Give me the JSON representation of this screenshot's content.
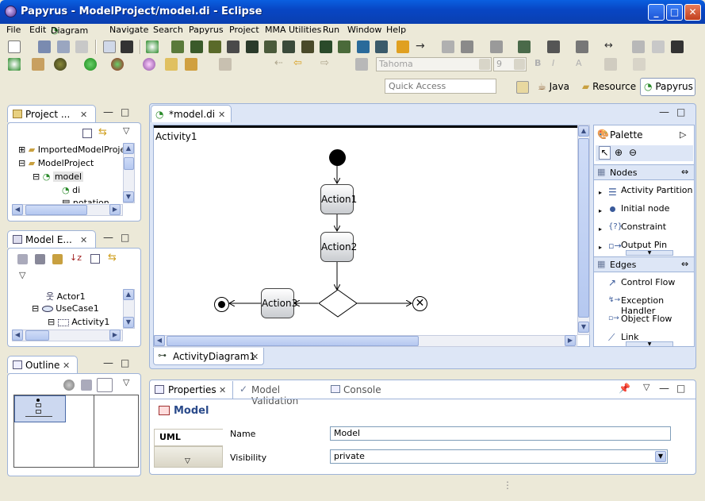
{
  "window": {
    "title": "Papyrus - ModelProject/model.di - Eclipse",
    "buttons": [
      "_",
      "□",
      "✕"
    ]
  },
  "menu": [
    "File",
    "Edit",
    "Diagram",
    "Navigate",
    "Search",
    "Papyrus",
    "Project",
    "MMA Utilities",
    "Run",
    "Window",
    "Help"
  ],
  "toolbar": {
    "font_name": "Tahoma",
    "font_size": "9",
    "quick_access_placeholder": "Quick Access",
    "perspectives": [
      {
        "label": "Java",
        "active": false
      },
      {
        "label": "Resource",
        "active": false
      },
      {
        "label": "Papyrus",
        "active": true
      }
    ]
  },
  "project_explorer": {
    "tab_label": "Project ...",
    "items": [
      {
        "label": "ImportedModelProject",
        "level": 0,
        "expander": "+"
      },
      {
        "label": "ModelProject",
        "level": 0,
        "expander": "-"
      },
      {
        "label": "model",
        "level": 1,
        "expander": "-",
        "selected": true
      },
      {
        "label": "di",
        "level": 2,
        "expander": ""
      },
      {
        "label": "notation",
        "level": 2,
        "expander": ""
      }
    ]
  },
  "model_explorer": {
    "tab_label": "Model E...",
    "items": [
      {
        "label": "Actor1",
        "level": 0,
        "icon": "actor"
      },
      {
        "label": "UseCase1",
        "level": 0,
        "icon": "usecase",
        "expander": "-"
      },
      {
        "label": "Activity1",
        "level": 1,
        "icon": "activity",
        "expander": "-"
      }
    ]
  },
  "outline": {
    "tab_label": "Outline"
  },
  "editor": {
    "tab_label": "*model.di",
    "activity_label": "Activity1",
    "actions": [
      "Action1",
      "Action2",
      "Action3"
    ],
    "diagram_tab_label": "ActivityDiagram1"
  },
  "palette": {
    "title": "Palette",
    "nodes_header": "Nodes",
    "nodes": [
      "Activity Partition",
      "Initial node",
      "Constraint",
      "Output Pin"
    ],
    "edges_header": "Edges",
    "edges": [
      "Control Flow",
      "Exception Handler",
      "Object Flow",
      "Link"
    ]
  },
  "properties": {
    "tabs": [
      "Properties",
      "Model Validation",
      "Console"
    ],
    "header": "Model",
    "side_tab": "UML",
    "name_label": "Name",
    "name_value": "Model",
    "visibility_label": "Visibility",
    "visibility_value": "private"
  },
  "colors": {
    "titlebar": "#0a4fd0",
    "panel_border": "#9eb3d8",
    "palette_header": "#dde6f6",
    "workbench_bg": "#ece9d8"
  }
}
